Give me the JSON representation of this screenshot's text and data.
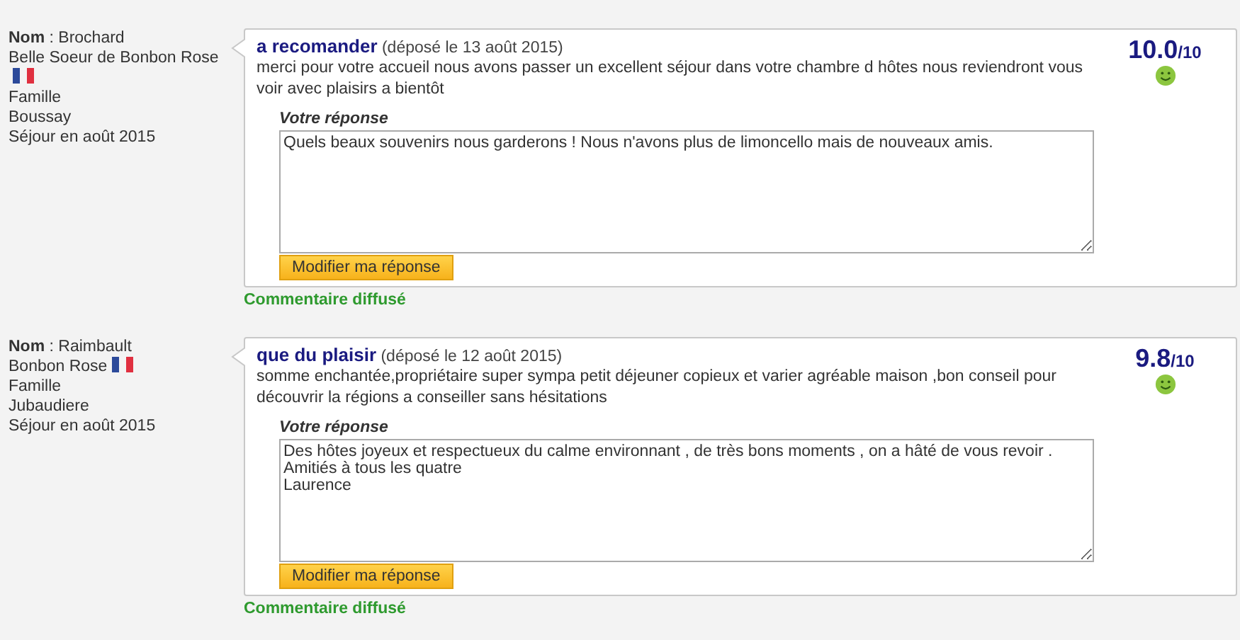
{
  "reviews": [
    {
      "reviewer": {
        "name": "**Nom** : Brochard",
        "lines": [
          {
            "text": "Belle Soeur de Bonbon Rose",
            "flag": true
          },
          {
            "text": "Famille",
            "flag": false
          },
          {
            "text": "Boussay",
            "flag": false
          },
          {
            "text": "Séjour en août 2015",
            "flag": false
          }
        ]
      },
      "title": "a recomander",
      "date": "(déposé le 13 août 2015)",
      "comment": "merci pour votre accueil nous avons passer un excellent séjour dans votre chambre d hôtes nous reviendront vous voir avec plaisirs a bientôt",
      "score": "10.0",
      "scale": "/10",
      "response_label": "Votre réponse",
      "response": "Quels beaux souvenirs nous garderons ! Nous n'avons plus de limoncello mais de nouveaux amis.",
      "button": "Modifier ma réponse",
      "status": "Commentaire diffusé"
    },
    {
      "reviewer": {
        "name": "**Nom** : Raimbault",
        "lines": [
          {
            "text": "Bonbon Rose",
            "flag": true
          },
          {
            "text": "Famille",
            "flag": false
          },
          {
            "text": "Jubaudiere",
            "flag": false
          },
          {
            "text": "Séjour en août 2015",
            "flag": false
          }
        ]
      },
      "title": "que du plaisir",
      "date": "(déposé le 12 août 2015)",
      "comment": "somme enchantée,propriétaire super sympa petit déjeuner copieux et varier agréable maison ,bon conseil pour découvrir la régions a conseiller sans hésitations",
      "score": "9.8",
      "scale": "/10",
      "response_label": "Votre réponse",
      "response": "Des hôtes joyeux et respectueux du calme environnant , de très bons moments , on a hâté de vous revoir .\nAmitiés à tous les quatre\nLaurence",
      "button": "Modifier ma réponse",
      "status": "Commentaire diffusé"
    }
  ]
}
